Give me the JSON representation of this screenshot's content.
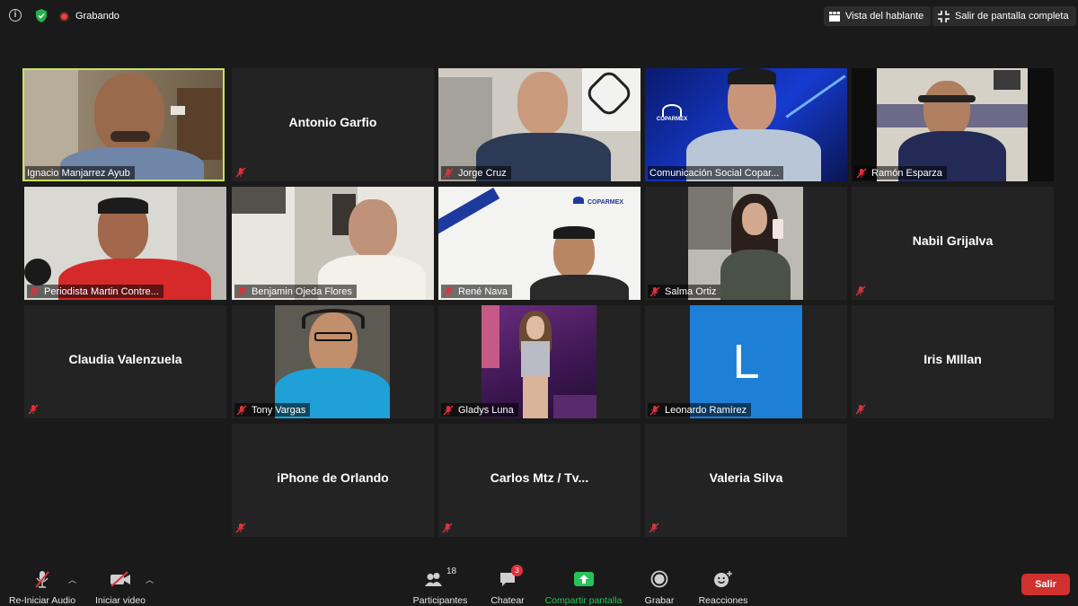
{
  "topbar": {
    "recording_label": "Grabando",
    "speaker_view_label": "Vista del hablante",
    "exit_fullscreen_label": "Salir de pantalla completa"
  },
  "tiles": [
    {
      "name": "Ignacio Manjarrez Ayub",
      "video": true
    },
    {
      "name": "Antonio Garfio",
      "video": false
    },
    {
      "name": "Jorge Cruz",
      "video": true
    },
    {
      "name": "Comunicación Social Copar...",
      "video": true
    },
    {
      "name": "Ramón Esparza",
      "video": true
    },
    {
      "name": "Periodista Martin Contre...",
      "video": true
    },
    {
      "name": "Benjamin Ojeda Flores",
      "video": true
    },
    {
      "name": "René Nava",
      "video": true
    },
    {
      "name": "Salma Ortiz",
      "video": true
    },
    {
      "name": "Nabil Grijalva",
      "video": false
    },
    {
      "name": "Claudia Valenzuela",
      "video": false
    },
    {
      "name": "Tony Vargas",
      "video": true
    },
    {
      "name": "Gladys Luna",
      "video": true
    },
    {
      "name": "Leonardo Ramírez",
      "video": true,
      "avatar_letter": "L"
    },
    {
      "name": "Iris MIllan",
      "video": false
    },
    {
      "name": "iPhone de Orlando",
      "video": false
    },
    {
      "name": "Carlos Mtz / Tv...",
      "video": false
    },
    {
      "name": "Valeria Silva",
      "video": false
    }
  ],
  "video_overlays": {
    "coparmex_logo_text": "COPARMEX",
    "coparmex_banner_text": "COPARMEX"
  },
  "toolbar": {
    "audio_label": "Re-Iniciar Audio",
    "video_label": "Iniciar video",
    "participants_label": "Participantes",
    "participants_count": "18",
    "chat_label": "Chatear",
    "chat_badge": "3",
    "share_label": "Compartir pantalla",
    "record_label": "Grabar",
    "reactions_label": "Reacciones",
    "leave_label": "Salir"
  },
  "colors": {
    "active_speaker_border": "#c5e160",
    "share_green": "#27c25a",
    "leave_red": "#d0312d",
    "avatar_blue": "#1d7fd6",
    "muted_red": "#e2303b"
  }
}
